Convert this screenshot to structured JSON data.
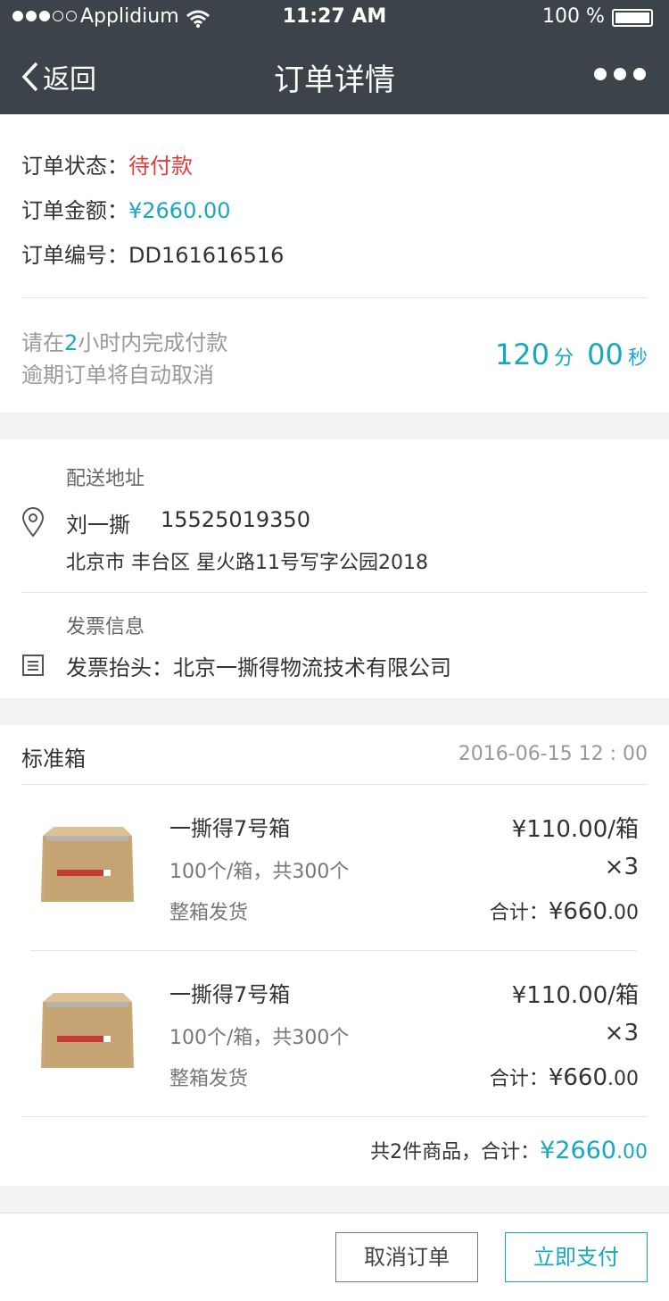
{
  "status_bar": {
    "carrier": "Applidium",
    "time": "11:27 AM",
    "battery": "100 %"
  },
  "nav": {
    "back_label": "返回",
    "title": "订单详情"
  },
  "order": {
    "status_label": "订单状态：",
    "status_value": "待付款",
    "amount_label": "订单金额：",
    "amount_value": "¥2660.00",
    "number_label": "订单编号：",
    "number_value": "DD161616516"
  },
  "countdown": {
    "line1_pre": "请在",
    "line1_hours": "2",
    "line1_post": "小时内完成付款",
    "line2": "逾期订单将自动取消",
    "minutes": "120",
    "minutes_unit": "分",
    "seconds": "00",
    "seconds_unit": "秒"
  },
  "delivery": {
    "title": "配送地址",
    "name": "刘一撕",
    "phone": "15525019350",
    "address": "北京市  丰台区  星火路11号写字公园2018"
  },
  "invoice": {
    "title": "发票信息",
    "header_label": "发票抬头：北京一撕得物流技术有限公司"
  },
  "goods": {
    "category": "标准箱",
    "datetime": "2016-06-15   12 : 00",
    "items": [
      {
        "name": "一撕得7号箱",
        "spec": "100个/箱，共300个",
        "ship": "整箱发货",
        "price": "¥110.00/箱",
        "qty": "×3",
        "subtotal_label": "合计：",
        "subtotal_main": "¥660",
        "subtotal_dec": ".00"
      },
      {
        "name": "一撕得7号箱",
        "spec": "100个/箱，共300个",
        "ship": "整箱发货",
        "price": "¥110.00/箱",
        "qty": "×3",
        "subtotal_label": "合计：",
        "subtotal_main": "¥660",
        "subtotal_dec": ".00"
      }
    ],
    "total_label": "共2件商品，合计：",
    "total_main": "¥2660",
    "total_dec": ".00"
  },
  "actions": {
    "cancel_label": "取消订单",
    "pay_label": "立即支付"
  },
  "colors": {
    "header": "#3d4449",
    "accent": "#1aa7c2",
    "alert": "#e83a3a"
  }
}
